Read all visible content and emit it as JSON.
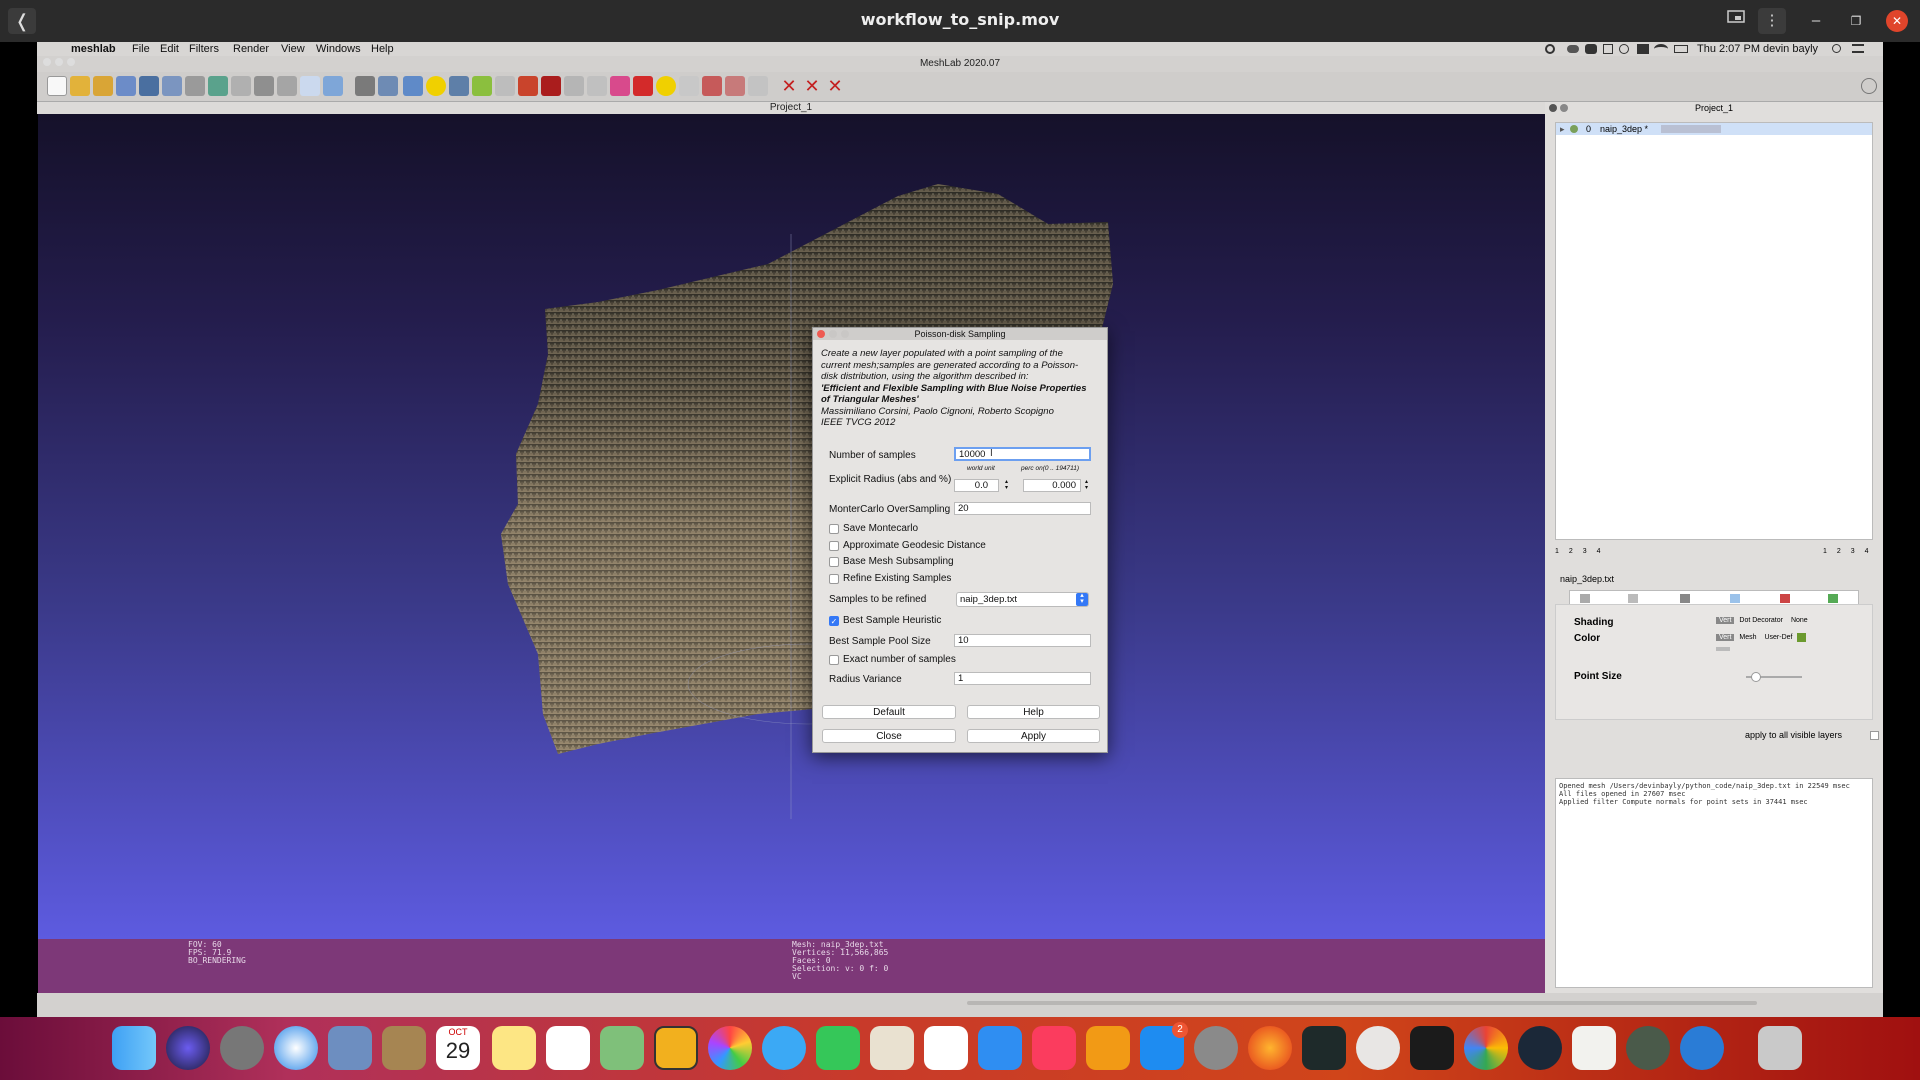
{
  "player": {
    "title": "workflow_to_snip.mov",
    "back_glyph": "❬",
    "minimize_glyph": "–",
    "maximize_glyph": "❐",
    "close_glyph": "✕",
    "menu_glyph": "⋮"
  },
  "menubar": {
    "apple": "",
    "app": "meshlab",
    "items": [
      "File",
      "Edit",
      "Filters",
      "Render",
      "View",
      "Windows",
      "Help"
    ],
    "clock": "Thu 2:07 PM",
    "user": "devin bayly"
  },
  "window": {
    "title": "MeshLab 2020.07",
    "project_title": "Project_1"
  },
  "viewport_status": {
    "left": [
      "FOV: 60",
      "FPS:    71.9",
      "BO_RENDERING"
    ],
    "center": [
      "Mesh: naip_3dep.txt",
      "Vertices: 11,566,865",
      "Faces: 0",
      "Selection: v: 0 f: 0",
      "VC"
    ]
  },
  "right_panel": {
    "title": "Project_1",
    "layer": {
      "index": "0",
      "name": "naip_3dep *"
    },
    "pager_left": [
      "1",
      "2",
      "3",
      "4"
    ],
    "pager_right": [
      "1",
      "2",
      "3",
      "4"
    ],
    "file_label": "naip_3dep.txt",
    "shading_label": "Shading",
    "shading_options": [
      "Vert",
      "Dot Decorator",
      "None"
    ],
    "color_label": "Color",
    "color_options": [
      "Vert",
      "Mesh",
      "User-Def"
    ],
    "point_size_label": "Point Size",
    "apply_all_label": "apply to all visible layers",
    "log": [
      "Opened mesh /Users/devinbayly/python_code/naip_3dep.txt in 22549 msec",
      "All files opened in 27607 msec",
      "Applied filter Compute normals for point sets in 37441 msec"
    ]
  },
  "dialog": {
    "title": "Poisson-disk Sampling",
    "desc_lines": [
      "Create a new layer populated with a point sampling of the",
      "current mesh;samples are generated according to a Poisson-",
      "disk distribution, using the algorithm described in:"
    ],
    "desc_bold": [
      "'Efficient and Flexible Sampling with Blue Noise Properties",
      "of Triangular Meshes'"
    ],
    "desc_tail": [
      "Massimiliano Corsini, Paolo Cignoni, Roberto Scopigno",
      "IEEE TVCG 2012"
    ],
    "num_samples_label": "Number of samples",
    "num_samples_value": "10000",
    "radius_label": "Explicit Radius (abs and %)",
    "world_unit_label": "world unit",
    "perc_label": "perc on(0 .. 194711)",
    "radius_abs": "0.0",
    "radius_perc": "0.000",
    "montecarlo_label": "MonterCarlo OverSampling",
    "montecarlo_value": "20",
    "checks": [
      {
        "label": "Save Montecarlo",
        "checked": false
      },
      {
        "label": "Approximate Geodesic Distance",
        "checked": false
      },
      {
        "label": "Base Mesh Subsampling",
        "checked": false
      },
      {
        "label": "Refine Existing Samples",
        "checked": false
      }
    ],
    "refine_label": "Samples to be refined",
    "refine_value": "naip_3dep.txt",
    "best_heuristic_label": "Best Sample Heuristic",
    "best_heuristic_checked": true,
    "pool_label": "Best Sample Pool Size",
    "pool_value": "10",
    "exact_label": "Exact number of samples",
    "exact_checked": false,
    "variance_label": "Radius Variance",
    "variance_value": "1",
    "buttons": {
      "default": "Default",
      "help": "Help",
      "close": "Close",
      "apply": "Apply"
    }
  },
  "dock": {
    "calendar_month": "OCT",
    "calendar_day": "29",
    "badge": "2"
  },
  "colors": {
    "viewport_bottom": "#5d5be0",
    "status_bar": "#7d3878",
    "accent_blue": "#3478f6"
  }
}
